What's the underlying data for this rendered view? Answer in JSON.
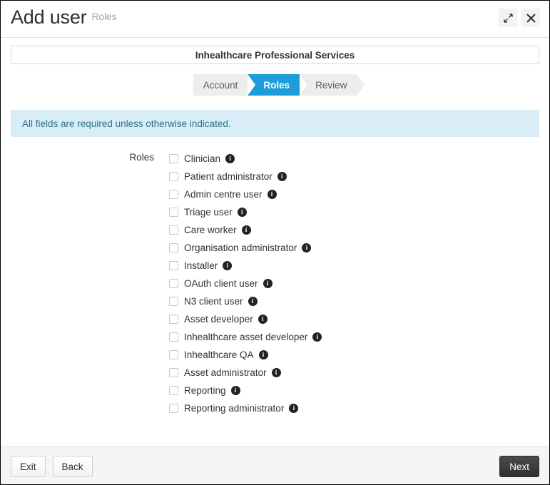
{
  "window": {
    "title": "Add user",
    "subtitle": "Roles",
    "expand_icon": "expand-icon",
    "close_icon": "close-icon"
  },
  "organisation": {
    "name": "Inhealthcare Professional Services"
  },
  "steps": [
    {
      "label": "Account",
      "active": false
    },
    {
      "label": "Roles",
      "active": true
    },
    {
      "label": "Review",
      "active": false
    }
  ],
  "info_banner": {
    "message": "All fields are required unless otherwise indicated."
  },
  "form": {
    "field_label": "Roles",
    "roles": [
      {
        "label": "Clinician",
        "checked": false
      },
      {
        "label": "Patient administrator",
        "checked": false
      },
      {
        "label": "Admin centre user",
        "checked": false
      },
      {
        "label": "Triage user",
        "checked": false
      },
      {
        "label": "Care worker",
        "checked": false
      },
      {
        "label": "Organisation administrator",
        "checked": false
      },
      {
        "label": "Installer",
        "checked": false
      },
      {
        "label": "OAuth client user",
        "checked": false
      },
      {
        "label": "N3 client user",
        "checked": false
      },
      {
        "label": "Asset developer",
        "checked": false
      },
      {
        "label": "Inhealthcare asset developer",
        "checked": false
      },
      {
        "label": "Inhealthcare QA",
        "checked": false
      },
      {
        "label": "Asset administrator",
        "checked": false
      },
      {
        "label": "Reporting",
        "checked": false
      },
      {
        "label": "Reporting administrator",
        "checked": false
      }
    ],
    "info_icon_glyph": "i"
  },
  "footer": {
    "exit_label": "Exit",
    "back_label": "Back",
    "next_label": "Next"
  },
  "colors": {
    "accent_blue": "#1b9dd9",
    "info_banner_bg": "#d9edf7",
    "info_banner_text": "#31708f",
    "primary_button_bg": "#3a3a3a",
    "step_inactive_bg": "#eceded"
  }
}
